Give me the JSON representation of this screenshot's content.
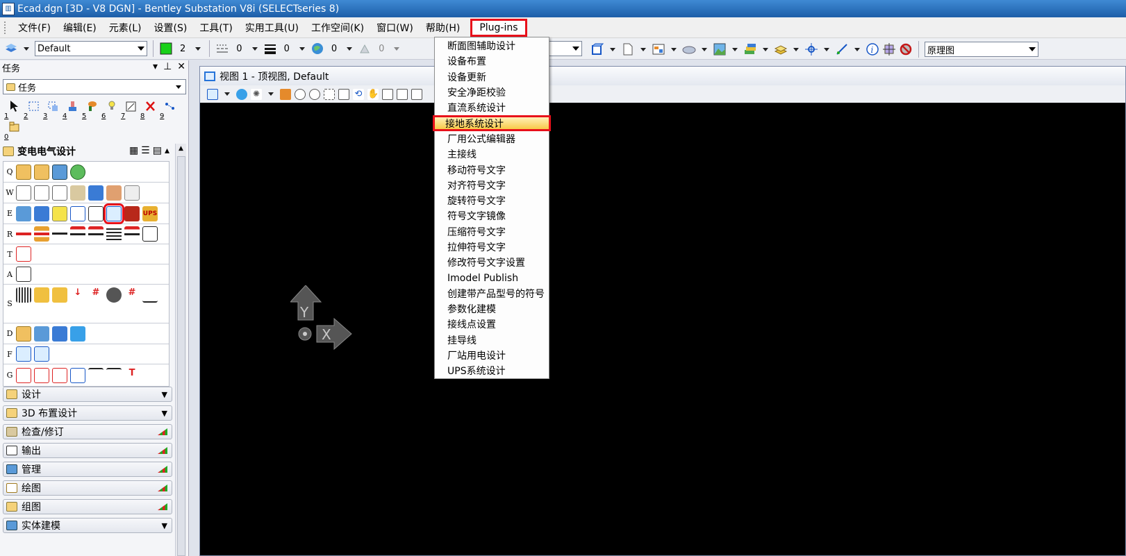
{
  "window": {
    "title": "Ecad.dgn [3D - V8 DGN] - Bentley Substation V8i (SELECTseries 8)"
  },
  "menubar": {
    "items": [
      "文件(F)",
      "编辑(E)",
      "元素(L)",
      "设置(S)",
      "工具(T)",
      "实用工具(U)",
      "工作空间(K)",
      "窗口(W)",
      "帮助(H)"
    ],
    "active": "Plug-ins"
  },
  "toolbar": {
    "level": "Default",
    "color_value": "2",
    "linestyle_value": "0",
    "weight_value": "0",
    "transparency_value": "0",
    "priority_value": "0",
    "right_combo": "原理图"
  },
  "taskpanel": {
    "header": "任务",
    "combo": "任务",
    "number_tools": [
      "1",
      "2",
      "3",
      "4",
      "5",
      "6",
      "7",
      "8",
      "9",
      "0"
    ],
    "group": "变电电气设计",
    "row_keys": [
      "Q",
      "W",
      "E",
      "R",
      "T",
      "A",
      "S",
      "D",
      "F",
      "G"
    ],
    "accordion": [
      "设计",
      "3D 布置设计",
      "检查/修订",
      "输出",
      "管理",
      "绘图",
      "组图",
      "实体建模"
    ]
  },
  "view": {
    "title": "视图 1 - 顶视图, Default",
    "axis_y": "Y",
    "axis_x": "X"
  },
  "dropdown": {
    "items": [
      "断面图辅助设计",
      "设备布置",
      "设备更新",
      "安全净距校验",
      "直流系统设计",
      "接地系统设计",
      "厂用公式编辑器",
      "主接线",
      "移动符号文字",
      "对齐符号文字",
      "旋转符号文字",
      "符号文字镜像",
      "压缩符号文字",
      "拉伸符号文字",
      "修改符号文字设置",
      "Imodel Publish",
      "创建带产品型号的符号",
      "参数化建模",
      "接线点设置",
      "挂导线",
      "厂站用电设计",
      "UPS系统设计"
    ],
    "highlighted_index": 5
  },
  "colors": {
    "highlight_border": "#e8101a",
    "titlebar": "#2a6fbf",
    "view_bg": "#000000"
  }
}
